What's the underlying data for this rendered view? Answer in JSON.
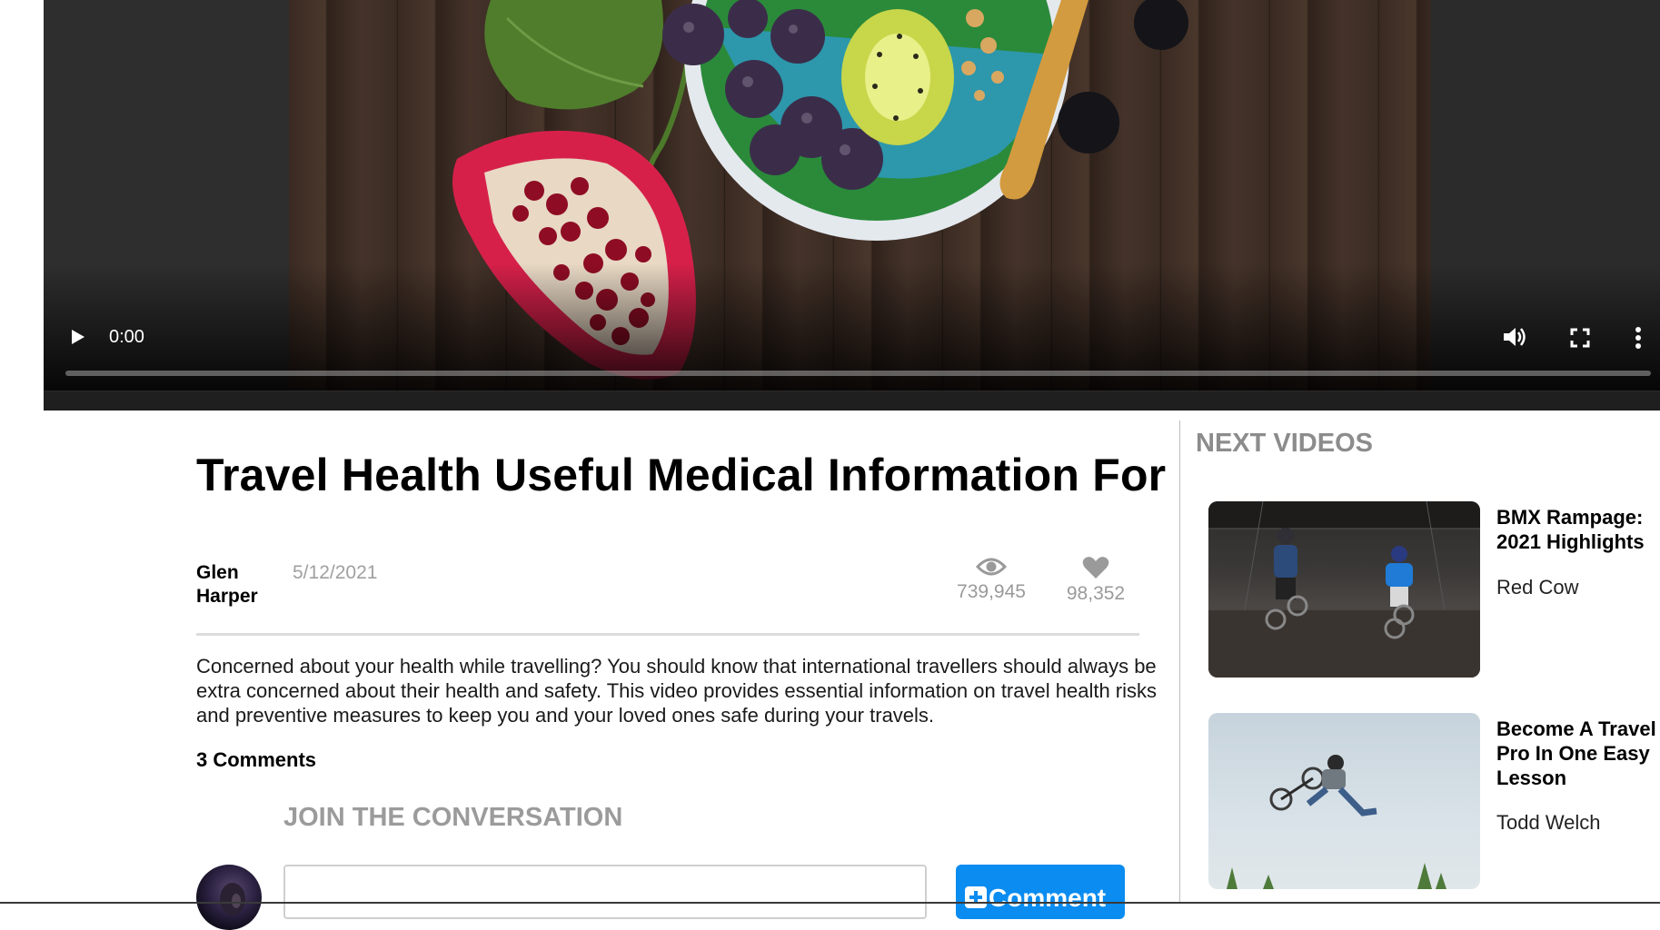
{
  "video": {
    "current_time": "0:00",
    "progress": 0
  },
  "article": {
    "title": "Travel Health Useful Medical Information For",
    "author": "Glen Harper",
    "date": "5/12/2021",
    "views": "739,945",
    "likes": "98,352",
    "description": "Concerned about your health while travelling? You should know that international travellers should always be extra concerned about their health and safety. This video provides essential information on travel health risks and preventive measures to keep you and your loved ones safe during your travels.",
    "comments_count": "3 Comments",
    "join_heading": "JOIN THE CONVERSATION",
    "comment_placeholder": "",
    "comment_button": "Comment"
  },
  "sidebar": {
    "heading": "NEXT VIDEOS",
    "videos": [
      {
        "title": "BMX Rampage: 2021 Highlights",
        "author": "Red Cow"
      },
      {
        "title": "Become A Travel Pro In One Easy Lesson",
        "author": "Todd Welch"
      }
    ]
  },
  "colors": {
    "accent": "#0a8cf0",
    "muted_text": "#9b9b9b",
    "divider": "#dcdcdc"
  },
  "icons": {
    "play": "play-icon",
    "volume": "volume-icon",
    "fullscreen": "fullscreen-icon",
    "more": "more-vertical-icon",
    "views": "eye-icon",
    "likes": "heart-icon"
  }
}
